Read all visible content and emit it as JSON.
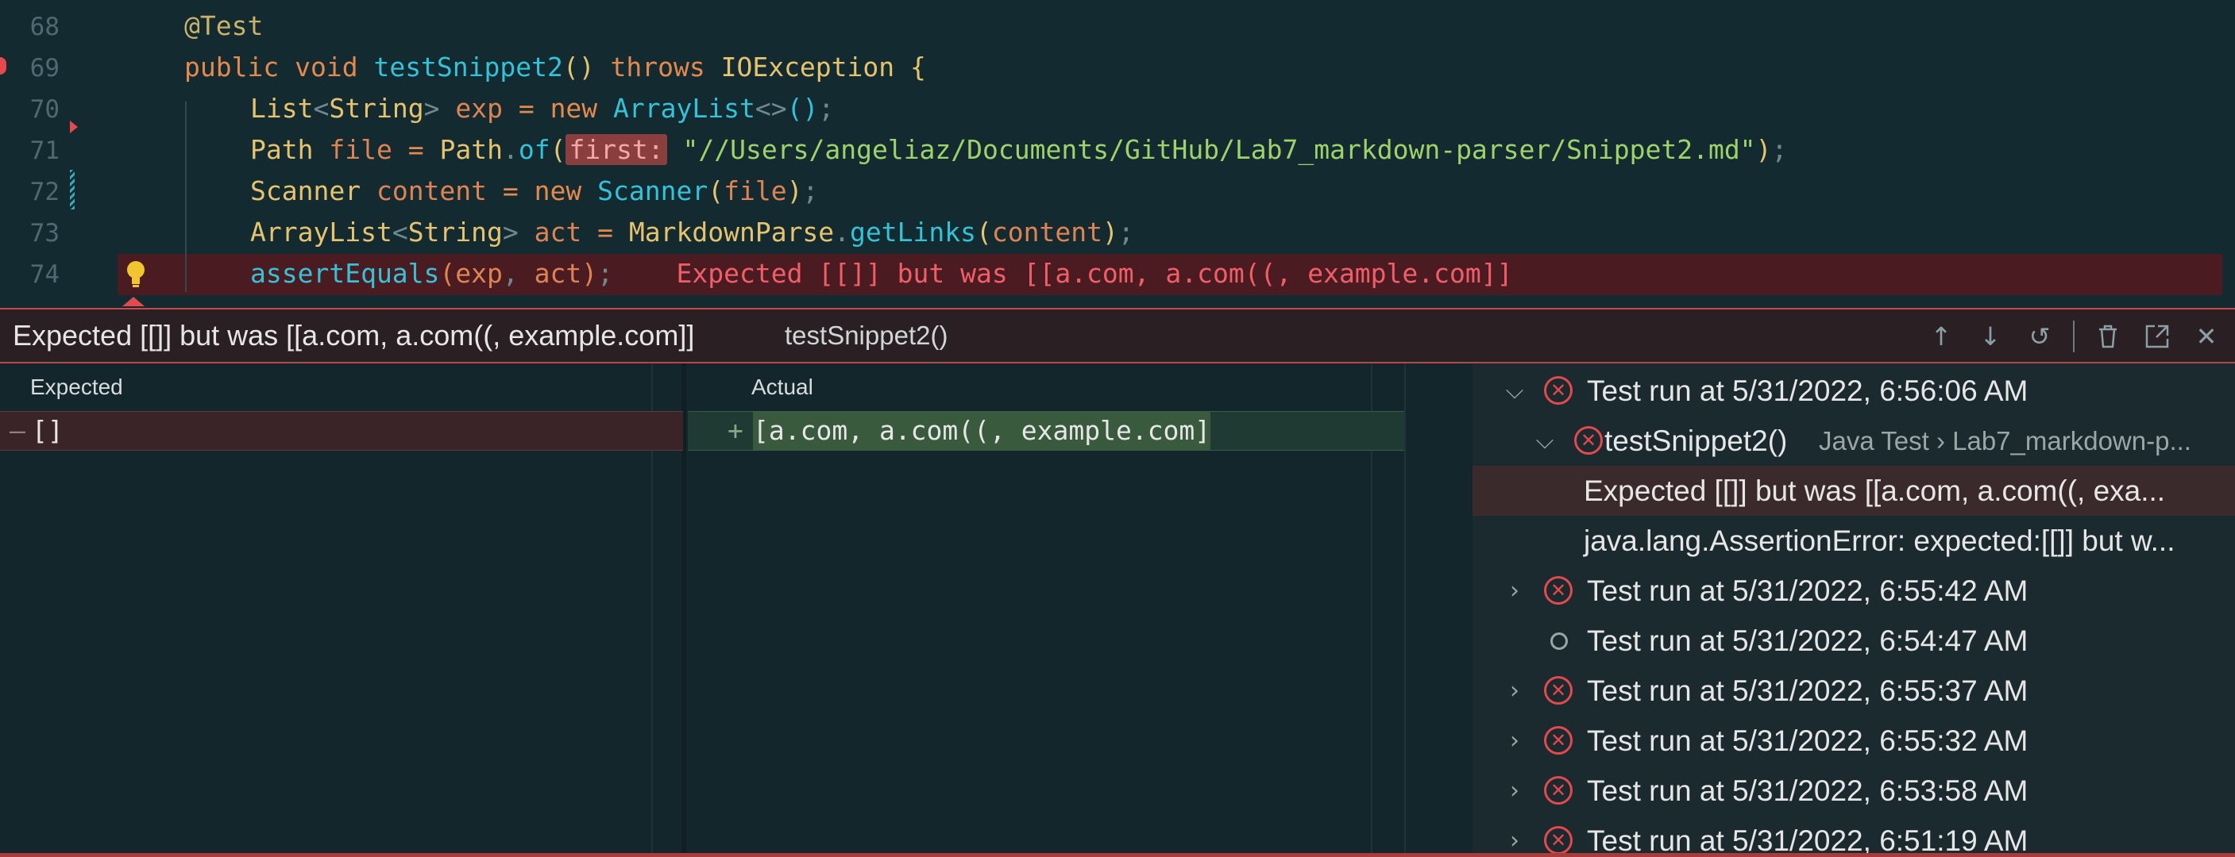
{
  "editor": {
    "line_numbers": [
      "68",
      "69",
      "70",
      "71",
      "72",
      "73",
      "74"
    ],
    "lines": [
      {
        "annotation": "@Test"
      },
      {
        "kw1": "public",
        "kw2": "void",
        "fn": "testSnippet2",
        "parens": "()",
        "throws": "throws",
        "exc": "IOException",
        "brace": "{"
      },
      {
        "type1": "List",
        "lt": "<",
        "type2": "String",
        "gt": ">",
        "var": "exp",
        "eq": "=",
        "new": "new",
        "cls": "ArrayList",
        "diamond": "<>",
        "call": "()",
        "semi": ";"
      },
      {
        "type": "Path",
        "var": "file",
        "eq": "=",
        "cls": "Path",
        "dot": ".",
        "fn": "of",
        "open": "(",
        "hint": "first:",
        "str": "\"//Users/angeliaz/Documents/GitHub/Lab7_markdown-parser/Snippet2.md\"",
        "close": ")",
        "semi": ";"
      },
      {
        "type": "Scanner",
        "var": "content",
        "eq": "=",
        "new": "new",
        "cls": "Scanner",
        "open": "(",
        "arg": "file",
        "close": ")",
        "semi": ";"
      },
      {
        "type1": "ArrayList",
        "lt": "<",
        "type2": "String",
        "gt": ">",
        "var": "act",
        "eq": "=",
        "cls": "MarkdownParse",
        "dot": ".",
        "fn": "getLinks",
        "open": "(",
        "arg": "content",
        "close": ")",
        "semi": ";"
      },
      {
        "fn": "assertEquals",
        "open": "(",
        "arg1": "exp",
        "comma": ",",
        "arg2": "act",
        "close": ")",
        "semi": ";",
        "error": "Expected [[]] but was [[a.com, a.com((, example.com]]"
      }
    ]
  },
  "panel": {
    "message": "Expected [[]] but was [[a.com, a.com((, example.com]]",
    "test_name": "testSnippet2()",
    "icons": [
      "arrow-up-icon",
      "arrow-down-icon",
      "history-icon",
      "trash-icon",
      "open-external-icon",
      "close-icon"
    ]
  },
  "diff": {
    "expected_title": "Expected",
    "actual_title": "Actual",
    "expected_marker": "—",
    "actual_marker": "+",
    "expected_value": "[]",
    "actual_value": "[a.com, a.com((, example.com]"
  },
  "results": [
    {
      "kind": "run",
      "status": "fail",
      "expanded": true,
      "label": "Test run at 5/31/2022, 6:56:06 AM"
    },
    {
      "kind": "test",
      "status": "fail",
      "expanded": true,
      "label": "testSnippet2()",
      "sub": "Java Test › Lab7_markdown-p..."
    },
    {
      "kind": "message",
      "label": "Expected [[]] but was [[a.com, a.com((, exa..."
    },
    {
      "kind": "message",
      "label": "java.lang.AssertionError: expected:[[]] but w..."
    },
    {
      "kind": "run",
      "status": "fail",
      "expanded": false,
      "label": "Test run at 5/31/2022, 6:55:42 AM"
    },
    {
      "kind": "run",
      "status": "skip",
      "label": "Test run at 5/31/2022, 6:54:47 AM"
    },
    {
      "kind": "run",
      "status": "fail",
      "expanded": false,
      "label": "Test run at 5/31/2022, 6:55:37 AM"
    },
    {
      "kind": "run",
      "status": "fail",
      "expanded": false,
      "label": "Test run at 5/31/2022, 6:55:32 AM"
    },
    {
      "kind": "run",
      "status": "fail",
      "expanded": false,
      "label": "Test run at 5/31/2022, 6:53:58 AM"
    },
    {
      "kind": "run",
      "status": "fail",
      "expanded": false,
      "label": "Test run at 5/31/2022, 6:51:19 AM"
    }
  ],
  "colors": {
    "error_red": "#e5484d",
    "editor_bg": "#132a30",
    "error_line_bg": "#4a1c22"
  }
}
